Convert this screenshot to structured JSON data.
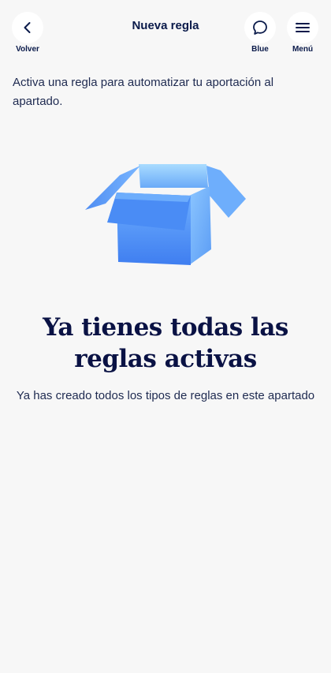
{
  "header": {
    "back_label": "Volver",
    "title": "Nueva regla",
    "chat_label": "Blue",
    "menu_label": "Menú"
  },
  "content": {
    "intro": "Activa una regla para automatizar tu aportación al apartado.",
    "headline": "Ya tienes todas las reglas activas",
    "subline": "Ya has creado todos los tipos de reglas en este apartado"
  },
  "colors": {
    "background": "#f7f7f7",
    "navy": "#0a1a4a",
    "box_blue": "#4a8cf5"
  },
  "icons": [
    "chevron-left-icon",
    "chat-bubble-icon",
    "menu-icon",
    "open-box-illustration"
  ]
}
